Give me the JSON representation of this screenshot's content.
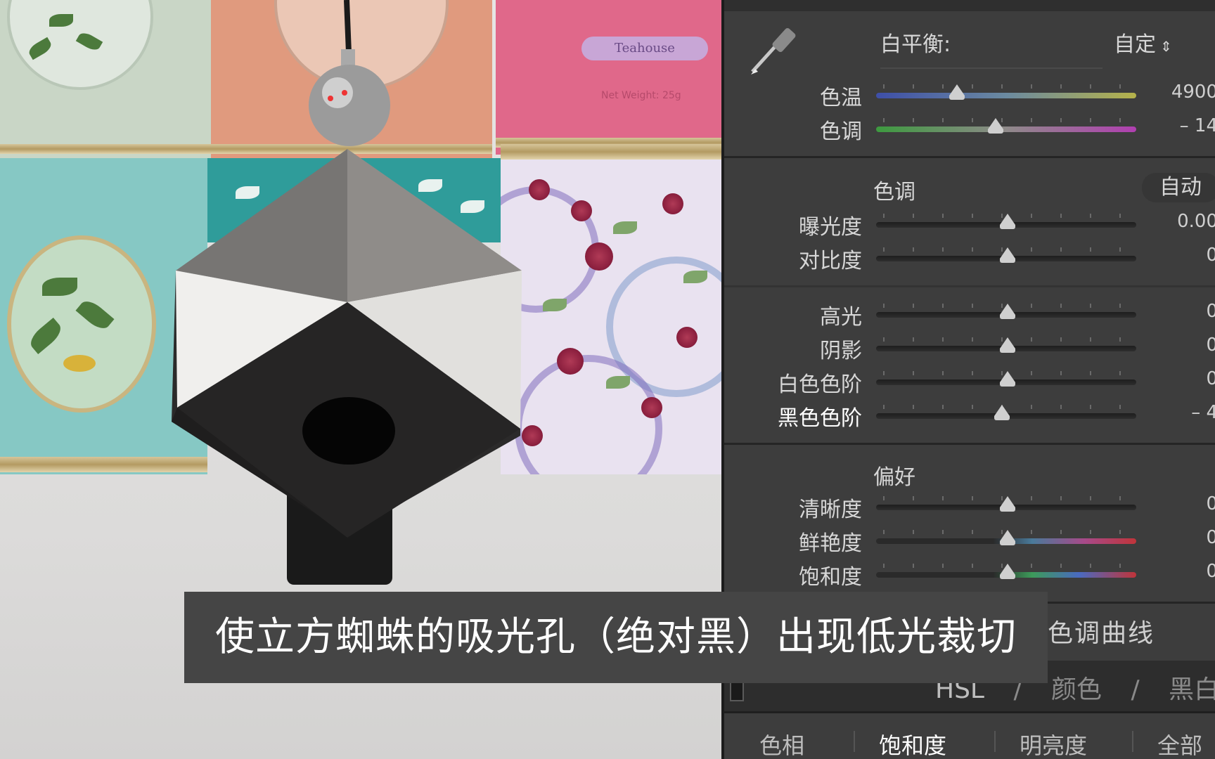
{
  "white_balance": {
    "label": "白平衡:",
    "mode": "自定",
    "sliders": [
      {
        "key": "temp",
        "label": "色温",
        "value": "4900",
        "pos": 0.31
      },
      {
        "key": "tint",
        "label": "色调",
        "value": "– 14",
        "pos": 0.46
      }
    ]
  },
  "tone": {
    "title": "色调",
    "auto": "自动",
    "sliders_a": [
      {
        "key": "exposure",
        "label": "曝光度",
        "value": "0.00",
        "pos": 0.505
      },
      {
        "key": "contrast",
        "label": "对比度",
        "value": "0",
        "pos": 0.505
      }
    ],
    "sliders_b": [
      {
        "key": "highlights",
        "label": "高光",
        "value": "0",
        "pos": 0.505
      },
      {
        "key": "shadows",
        "label": "阴影",
        "value": "0",
        "pos": 0.505
      },
      {
        "key": "whites",
        "label": "白色色阶",
        "value": "0",
        "pos": 0.505
      },
      {
        "key": "blacks",
        "label": "黑色色阶",
        "value": "– 4",
        "pos": 0.485
      }
    ]
  },
  "presence": {
    "title": "偏好",
    "sliders": [
      {
        "key": "clarity",
        "label": "清晰度",
        "value": "0",
        "pos": 0.505
      },
      {
        "key": "vibrance",
        "label": "鲜艳度",
        "value": "0",
        "pos": 0.505
      },
      {
        "key": "saturation",
        "label": "饱和度",
        "value": "0",
        "pos": 0.505
      }
    ]
  },
  "panels": {
    "tone_curve": "色调曲线",
    "hsl": "HSL",
    "sep": "/",
    "color": "颜色",
    "bw": "黑白"
  },
  "hsl_tabs": [
    "色相",
    "饱和度",
    "明亮度",
    "全部"
  ],
  "tin_label": "Teahouse",
  "tin_weight": "Net Weight: 25g",
  "caption": "使立方蜘蛛的吸光孔（绝对黑）出现低光裁切",
  "colors": {
    "panel": "#3d3d3d",
    "panel_dark": "#262626",
    "caption_bg": "#454545"
  }
}
